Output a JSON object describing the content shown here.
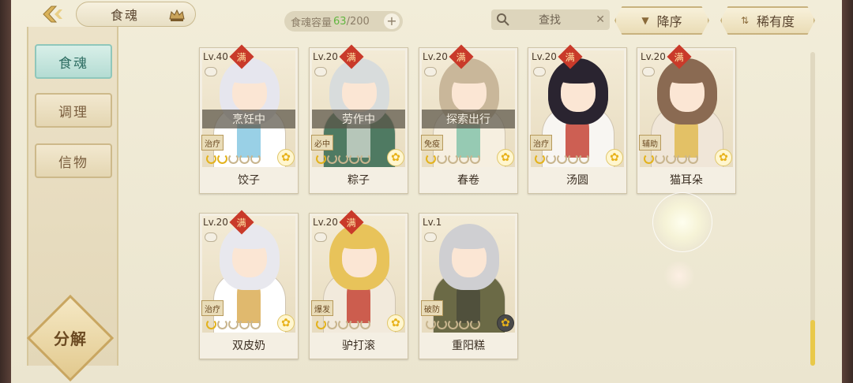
{
  "header": {
    "title": "食魂",
    "capacity_label": "食魂容量",
    "capacity_current": "63",
    "capacity_max": "/200",
    "capacity_add": "+",
    "search_placeholder": "查找",
    "search_clear": "✕",
    "sort_order": "降序",
    "sort_field": "稀有度"
  },
  "sidebar": {
    "items": [
      {
        "label": "食魂",
        "active": true
      },
      {
        "label": "调理",
        "active": false
      },
      {
        "label": "信物",
        "active": false
      }
    ],
    "decompose_label": "分解"
  },
  "cards": [
    {
      "level": "Lv.40",
      "full": "满",
      "status": "烹饪中",
      "role": "治疗",
      "name": "饺子",
      "stars_on": 2
    },
    {
      "level": "Lv.20",
      "full": "满",
      "status": "劳作中",
      "role": "必中",
      "name": "粽子",
      "stars_on": 1
    },
    {
      "level": "Lv.20",
      "full": "满",
      "status": "探索出行",
      "role": "免疫",
      "name": "春卷",
      "stars_on": 1
    },
    {
      "level": "Lv.20",
      "full": "满",
      "status": "",
      "role": "治疗",
      "name": "汤圆",
      "stars_on": 1
    },
    {
      "level": "Lv.20",
      "full": "满",
      "status": "",
      "role": "辅助",
      "name": "猫耳朵",
      "stars_on": 1
    },
    {
      "level": "Lv.20",
      "full": "满",
      "status": "",
      "role": "治疗",
      "name": "双皮奶",
      "stars_on": 1
    },
    {
      "level": "Lv.20",
      "full": "满",
      "status": "",
      "role": "爆发",
      "name": "驴打滚",
      "stars_on": 1
    },
    {
      "level": "Lv.1",
      "full": "",
      "status": "",
      "role": "破防",
      "name": "重阳糕",
      "stars_on": 0
    }
  ],
  "colors": {
    "accent_green": "#62b640",
    "full_badge": "#c93a2a",
    "star_gold": "#e3b21c"
  }
}
